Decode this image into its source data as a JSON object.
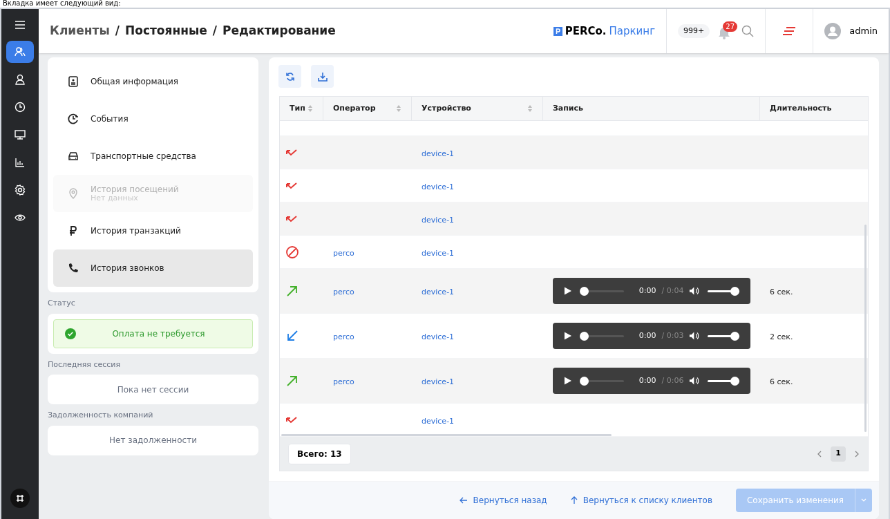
{
  "caption": "Вкладка имеет следующий вид:",
  "rail": [
    {
      "selected": true
    },
    {
      "selected": false
    },
    {
      "selected": false
    },
    {
      "selected": false
    },
    {
      "selected": false
    },
    {
      "selected": false
    },
    {
      "selected": false
    }
  ],
  "breadcrumb": [
    "Клиенты",
    "Постоянные",
    "Редактирование"
  ],
  "breadcrumb_separator": "/",
  "brand": {
    "name": "PERCo.",
    "product": "Паркинг"
  },
  "header": {
    "counter": "999+",
    "notifications": "27",
    "user": "admin"
  },
  "nav": [
    {
      "label": "Общая информация",
      "disabled": false,
      "selected": false
    },
    {
      "label": "События",
      "disabled": false,
      "selected": false
    },
    {
      "label": "Транспортные средства",
      "disabled": false,
      "selected": false
    },
    {
      "label": "История посещений",
      "note": "Нет данных",
      "disabled": true,
      "selected": false
    },
    {
      "label": "История транзакций",
      "disabled": false,
      "selected": false
    },
    {
      "label": "История звонков",
      "disabled": false,
      "selected": true
    }
  ],
  "status": {
    "label": "Статус",
    "value": "Оплата не требуется"
  },
  "session": {
    "label": "Последняя сессия",
    "value": "Пока нет сессии"
  },
  "debt": {
    "label": "Задолженность компаний",
    "value": "Нет задолженности"
  },
  "table": {
    "columns": [
      {
        "label": "Тип",
        "sortable": true
      },
      {
        "label": "Оператор",
        "sortable": true
      },
      {
        "label": "Устройство",
        "sortable": true
      },
      {
        "label": "Запись",
        "sortable": false
      },
      {
        "label": "Длительность",
        "sortable": false
      }
    ],
    "rows": [
      {
        "kind": "missed",
        "device": "device-1"
      },
      {
        "kind": "missed",
        "device": "device-1"
      },
      {
        "kind": "missed",
        "device": "device-1"
      },
      {
        "kind": "blocked",
        "operator": "perco",
        "device": "device-1"
      },
      {
        "kind": "outgoing",
        "operator": "perco",
        "device": "device-1",
        "record": {
          "current": "0:00",
          "total": "/ 0:04",
          "position": {
            "level": 0
          },
          "volume": {
            "level": 1
          }
        },
        "duration": "6 сек."
      },
      {
        "kind": "incoming",
        "operator": "perco",
        "device": "device-1",
        "record": {
          "current": "0:00",
          "total": "/ 0:03",
          "position": {
            "level": 0
          },
          "volume": {
            "level": 1
          }
        },
        "duration": "2 сек."
      },
      {
        "kind": "outgoing",
        "operator": "perco",
        "device": "device-1",
        "record": {
          "current": "0:00",
          "total": "/ 0:06",
          "position": {
            "level": 0
          },
          "volume": {
            "level": 1
          }
        },
        "duration": "6 сек."
      },
      {
        "kind": "missed",
        "device": "device-1"
      }
    ],
    "total": "Всего: 13",
    "pages": [
      {
        "label": "1",
        "selected": true
      }
    ]
  },
  "actions": {
    "back": "Вернуться назад",
    "to_list": "Вернуться к списку клиентов",
    "save": "Сохранить изменения",
    "save_disabled": true
  }
}
